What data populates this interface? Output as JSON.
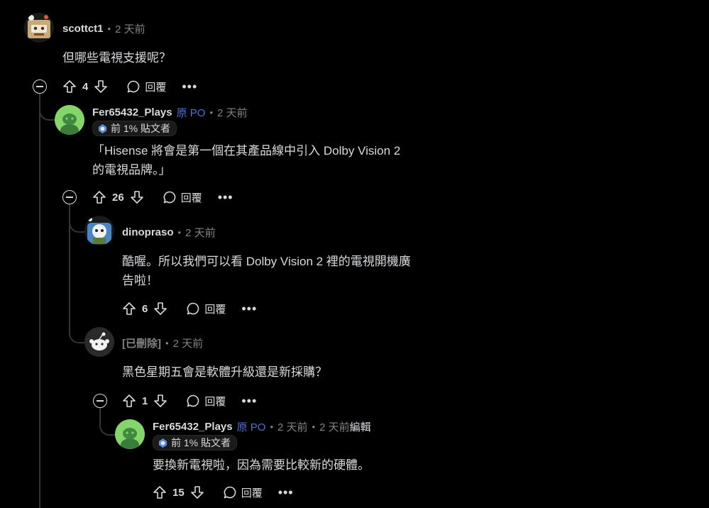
{
  "comments": [
    {
      "user": "scottct1",
      "time": "2 天前",
      "body": "但哪些電視支援呢？",
      "votes": "4",
      "reply": "回覆",
      "more": "•••"
    },
    {
      "user": "Fer65432_Plays",
      "op": "原 PO",
      "time": "2 天前",
      "badge": "前 1% 貼文者",
      "body_line1": "「Hisense 將會是第一個在其產品線中引入 Dolby Vision 2",
      "body_line2": "的電視品牌。」",
      "votes": "26",
      "reply": "回覆",
      "more": "•••"
    },
    {
      "user": "dinopraso",
      "time": "2 天前",
      "body_line1": "酷喔。所以我們可以看 Dolby Vision 2 裡的電視開機廣",
      "body_line2": "告啦！",
      "votes": "6",
      "reply": "回覆",
      "more": "•••"
    },
    {
      "user": "[已刪除]",
      "time": "2 天前",
      "body": "黑色星期五會是軟體升級還是新採購？",
      "votes": "1",
      "reply": "回覆",
      "more": "•••"
    },
    {
      "user": "Fer65432_Plays",
      "op": "原 PO",
      "time": "2 天前",
      "time2": "2 天前",
      "edited": "編輯",
      "badge": "前 1% 貼文者",
      "body": "要換新電視啦，因為需要比較新的硬體。",
      "votes": "15",
      "reply": "回覆",
      "more": "•••"
    }
  ],
  "sep": "•",
  "colors": {
    "bg": "#000000",
    "text": "#d7dadc",
    "muted": "#818384",
    "op": "#4f72d6",
    "thread_line": "#343536"
  }
}
